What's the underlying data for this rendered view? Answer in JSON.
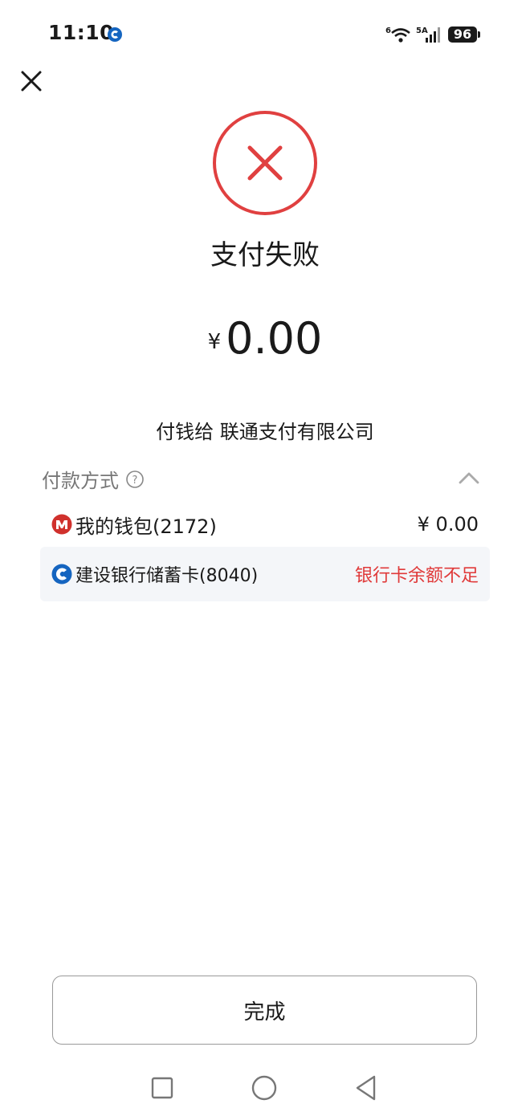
{
  "status_bar": {
    "time": "11:10",
    "net_wifi": "6",
    "net_cell": "5A",
    "battery": "96"
  },
  "result": {
    "title": "支付失败",
    "currency": "¥",
    "amount": "0.00",
    "payee": "付钱给 联通支付有限公司",
    "status_color": "#e04040"
  },
  "payment": {
    "label": "付款方式",
    "methods": [
      {
        "name": "我的钱包(2172)",
        "value": "¥ 0.00",
        "icon": "wallet-brand-icon"
      },
      {
        "name": "建设银行储蓄卡(8040)",
        "value": "银行卡余额不足",
        "icon": "ccb-bank-icon",
        "value_color": "#e03a3a"
      }
    ]
  },
  "actions": {
    "done_label": "完成"
  }
}
